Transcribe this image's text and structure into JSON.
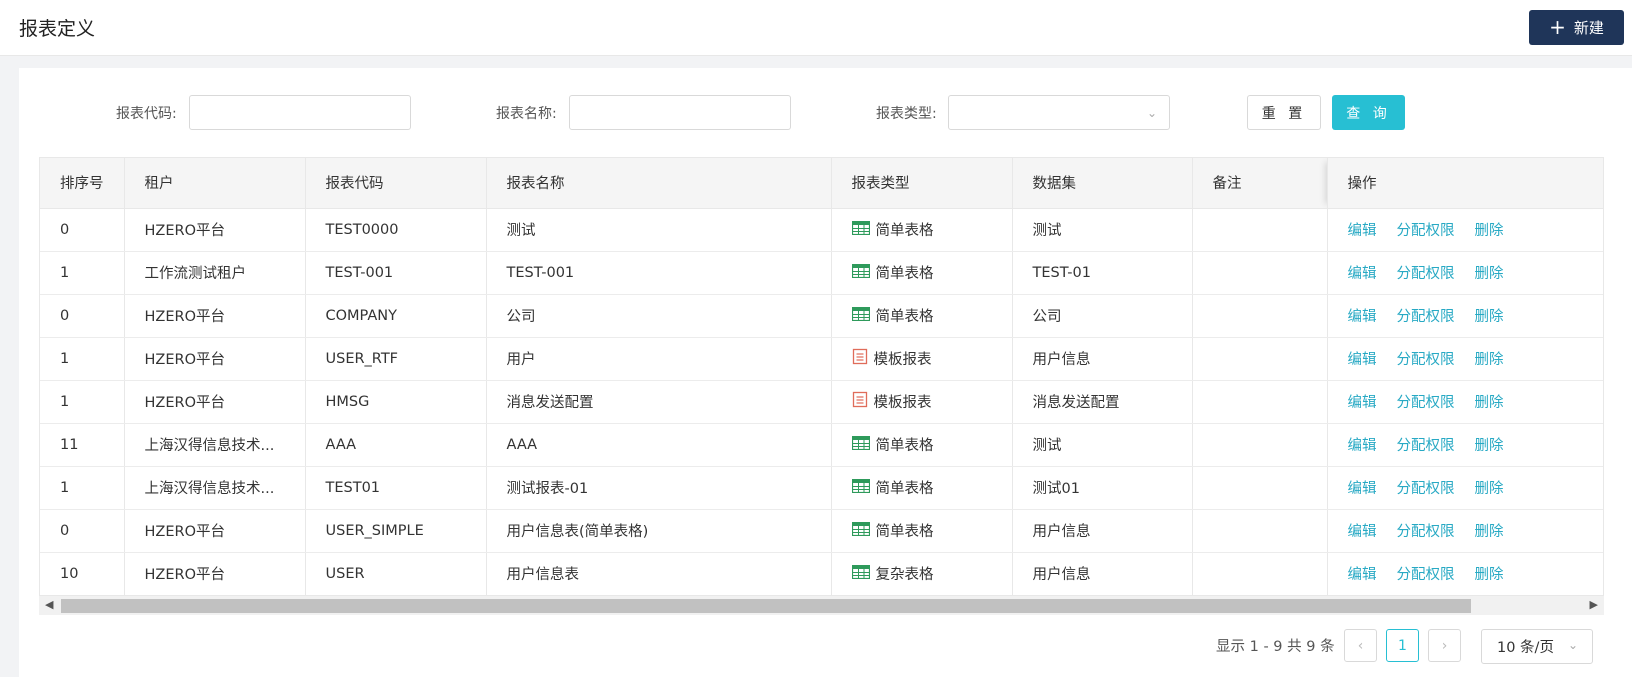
{
  "header": {
    "title": "报表定义",
    "new_label": "新建"
  },
  "search": {
    "code_label": "报表代码:",
    "name_label": "报表名称:",
    "type_label": "报表类型:",
    "reset_label": "重 置",
    "query_label": "查 询"
  },
  "table": {
    "columns": [
      "排序号",
      "租户",
      "报表代码",
      "报表名称",
      "报表类型",
      "数据集",
      "备注",
      "操作"
    ],
    "rows": [
      {
        "order": "0",
        "tenant": "HZERO平台",
        "code": "TEST0000",
        "name": "测试",
        "type": "简单表格",
        "type_icon": "table-grid-icon",
        "dataset": "测试",
        "remark": ""
      },
      {
        "order": "1",
        "tenant": "工作流测试租户",
        "code": "TEST-001",
        "name": "TEST-001",
        "type": "简单表格",
        "type_icon": "table-grid-icon",
        "dataset": "TEST-01",
        "remark": ""
      },
      {
        "order": "0",
        "tenant": "HZERO平台",
        "code": "COMPANY",
        "name": "公司",
        "type": "简单表格",
        "type_icon": "table-grid-icon",
        "dataset": "公司",
        "remark": ""
      },
      {
        "order": "1",
        "tenant": "HZERO平台",
        "code": "USER_RTF",
        "name": "用户",
        "type": "模板报表",
        "type_icon": "template-doc-icon",
        "dataset": "用户信息",
        "remark": ""
      },
      {
        "order": "1",
        "tenant": "HZERO平台",
        "code": "HMSG",
        "name": "消息发送配置",
        "type": "模板报表",
        "type_icon": "template-doc-icon",
        "dataset": "消息发送配置",
        "remark": ""
      },
      {
        "order": "11",
        "tenant": "上海汉得信息技术...",
        "code": "AAA",
        "name": "AAA",
        "type": "简单表格",
        "type_icon": "table-grid-icon",
        "dataset": "测试",
        "remark": ""
      },
      {
        "order": "1",
        "tenant": "上海汉得信息技术...",
        "code": "TEST01",
        "name": "测试报表-01",
        "type": "简单表格",
        "type_icon": "table-grid-icon",
        "dataset": "测试01",
        "remark": ""
      },
      {
        "order": "0",
        "tenant": "HZERO平台",
        "code": "USER_SIMPLE",
        "name": "用户信息表(简单表格)",
        "type": "简单表格",
        "type_icon": "table-grid-icon",
        "dataset": "用户信息",
        "remark": ""
      },
      {
        "order": "10",
        "tenant": "HZERO平台",
        "code": "USER",
        "name": "用户信息表",
        "type": "复杂表格",
        "type_icon": "table-grid-icon",
        "dataset": "用户信息",
        "remark": ""
      }
    ],
    "actions": {
      "edit": "编辑",
      "assign": "分配权限",
      "delete": "删除"
    }
  },
  "pagination": {
    "total_text": "显示 1 - 9 共 9 条",
    "current_page": "1",
    "page_size": "10 条/页"
  },
  "colors": {
    "primary_dark": "#1f3559",
    "accent": "#27bfd3",
    "link": "#27a9c4",
    "grid_icon": "#2e9a5b",
    "doc_icon": "#e06c5a"
  }
}
